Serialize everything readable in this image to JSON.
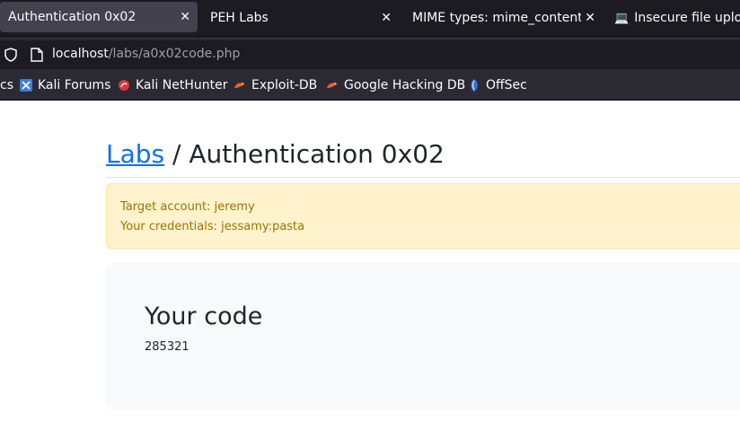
{
  "tabs": [
    {
      "label": "Authentication 0x02",
      "active": true
    },
    {
      "label": "PEH Labs",
      "active": false
    },
    {
      "label": "MIME types: mime_content_t",
      "active": false
    },
    {
      "label": "Insecure file upload",
      "active": false
    }
  ],
  "url": {
    "host": "localhost",
    "path": "/labs/a0x02code.php"
  },
  "bookmarks": [
    {
      "label": "cs"
    },
    {
      "label": "Kali Forums"
    },
    {
      "label": "Kali NetHunter"
    },
    {
      "label": "Exploit-DB"
    },
    {
      "label": "Google Hacking DB"
    },
    {
      "label": "OffSec"
    }
  ],
  "page": {
    "breadcrumb_link": "Labs",
    "separator": " / ",
    "title": "Authentication 0x02",
    "alert_target": "Target account: jeremy",
    "alert_credentials": "Your credentials: jessamy:pasta",
    "code_title": "Your code",
    "code_value": "285321"
  },
  "colors": {
    "accent": "#0d6efd",
    "alert_bg": "#fff3cd",
    "alert_text": "#997404",
    "tabbar": "#1c1b22"
  }
}
